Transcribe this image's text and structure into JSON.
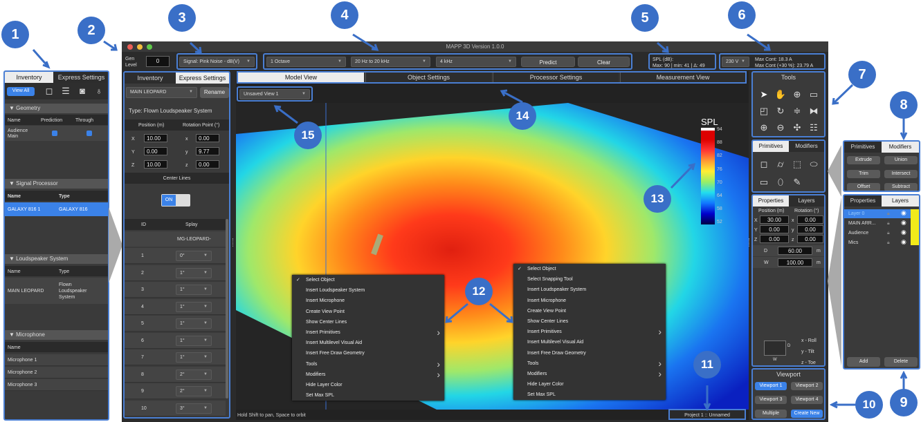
{
  "callouts": [
    "1",
    "2",
    "3",
    "4",
    "5",
    "6",
    "7",
    "8",
    "9",
    "10",
    "11",
    "12",
    "13",
    "14",
    "15"
  ],
  "window": {
    "title": "MAPP 3D Version 1.0.0"
  },
  "toolbar": {
    "gen_label1": "Gen",
    "gen_label2": "Level",
    "gen_value": "0",
    "signal": "Signal: Pink Noise - dB(V)",
    "octave": "1 Octave",
    "range": "20 Hz to 20 kHz",
    "freq": "4 kHz",
    "predict": "Predict",
    "clear": "Clear",
    "spl_title": "SPL (dB):",
    "spl_values": "Max: 90  | min: 41 | Δ: 49",
    "voltage": "230 V",
    "max_cont": "Max Cont: 18.3  A",
    "max_cont30": "Max Cont (+30 %): 23.79  A"
  },
  "left_panel": {
    "tabs": [
      "Inventory",
      "Express Settings"
    ],
    "view_all": "View All",
    "geometry": {
      "title": "Geometry",
      "cols": [
        "Name",
        "Prediction",
        "Through"
      ],
      "row": [
        "Audience",
        "Main"
      ]
    },
    "signal": {
      "title": "Signal Processor",
      "cols": [
        "Name",
        "Type"
      ],
      "row": [
        "GALAXY 816 1",
        "GALAXY 816"
      ]
    },
    "loudspeaker": {
      "title": "Loudspeaker System",
      "cols": [
        "Name",
        "Type"
      ],
      "row_name": "MAIN LEOPARD",
      "row_type": [
        "Flown",
        "Loudspeaker",
        "System"
      ]
    },
    "microphone": {
      "title": "Microphone",
      "col": "Name",
      "rows": [
        "Microphone 1",
        "Microphone 2",
        "Microphone 3"
      ]
    }
  },
  "express": {
    "tabs": [
      "Inventory",
      "Express Settings"
    ],
    "select": "MAIN LEOPARD",
    "rename": "Rename",
    "type": "Type:  Flown Loudspeaker System",
    "position_label": "Position (m)",
    "rotation_label": "Rotation Point (°)",
    "rows": [
      {
        "a": "X",
        "v": "10.00",
        "b": "x",
        "w": "0.00"
      },
      {
        "a": "Y",
        "v": "0.00",
        "b": "y",
        "w": "9.77"
      },
      {
        "a": "Z",
        "v": "10.00",
        "b": "z",
        "w": "0.00"
      }
    ],
    "center_lines": "Center Lines",
    "on": "ON",
    "cols": [
      "ID",
      "Splay"
    ],
    "model": "MG-LEOPARD-",
    "splay": [
      {
        "id": "1",
        "v": "0°"
      },
      {
        "id": "2",
        "v": "1°"
      },
      {
        "id": "3",
        "v": "1°"
      },
      {
        "id": "4",
        "v": "1°"
      },
      {
        "id": "5",
        "v": "1°"
      },
      {
        "id": "6",
        "v": "1°"
      },
      {
        "id": "7",
        "v": "1°"
      },
      {
        "id": "8",
        "v": "2°"
      },
      {
        "id": "9",
        "v": "2°"
      },
      {
        "id": "10",
        "v": "3°"
      }
    ]
  },
  "main": {
    "tabs": [
      "Model View",
      "Object Settings",
      "Processor Settings",
      "Measurement View"
    ],
    "view_select": "Unsaved View 1",
    "status": "Hold Shift to pan, Space to orbit",
    "project": "Project 1 :: Unnamed",
    "legend_title": "SPL",
    "legend_ticks": [
      "94",
      "88",
      "82",
      "76",
      "70",
      "64",
      "58",
      "52"
    ]
  },
  "context_menu": [
    "Select Object",
    "Select Snapping Tool",
    "Insert Loudspeaker System",
    "Insert Microphone",
    "Create View Point",
    "Show Center Lines",
    "Insert Primitives",
    "Insert Multilevel Visual Aid",
    "Insert Free Draw Geometry",
    "Tools",
    "Modifiers",
    "Hide Layer Color",
    "Set Max SPL"
  ],
  "context_menu_left": [
    "Select Object",
    "Insert Loudspeaker System",
    "Insert Microphone",
    "Create View Point",
    "Show Center Lines",
    "Insert Primitives",
    "Insert Multilevel Visual Aid",
    "Insert Free Draw Geometry",
    "Tools",
    "Modifiers",
    "Hide Layer Color",
    "Set Max SPL"
  ],
  "tools": {
    "title": "Tools"
  },
  "primitives": {
    "tabs": [
      "Primitives",
      "Modifiers"
    ]
  },
  "modifiers": {
    "tabs": [
      "Primitives",
      "Modifiers"
    ],
    "buttons": [
      "Extrude",
      "Union",
      "Trim",
      "Intersect",
      "Offset",
      "Subtract"
    ]
  },
  "properties": {
    "tabs": [
      "Properties",
      "Layers"
    ],
    "pos": "Position (m)",
    "rot": "Rotation (°)",
    "rows": [
      {
        "a": "X",
        "v": "30.00",
        "b": "x",
        "w": "0.00"
      },
      {
        "a": "Y",
        "v": "0.00",
        "b": "y",
        "w": "0.00"
      },
      {
        "a": "Z",
        "v": "0.00",
        "b": "z",
        "w": "0.00"
      }
    ],
    "d_label": "D",
    "d_val": "60.00",
    "w_label": "W",
    "w_val": "100.00",
    "unit": "m",
    "box_d": "D",
    "box_w": "W",
    "roll": "x - Roll",
    "tilt": "y - Tilt",
    "toe": "z - Toe"
  },
  "layers": {
    "tabs": [
      "Properties",
      "Layers"
    ],
    "items": [
      "Layer 0",
      "MAIN ARR...",
      "Audience",
      "Mics"
    ],
    "add": "Add",
    "delete": "Delete"
  },
  "viewport": {
    "title": "Viewport",
    "buttons": [
      "Viewport 1",
      "Viewport 2",
      "Viewport 3",
      "Viewport 4",
      "Multiple",
      "Create New"
    ]
  },
  "colors": {
    "accent": "#3b82e8",
    "callout": "#3a6fc7",
    "panel": "#3a3a3a"
  }
}
